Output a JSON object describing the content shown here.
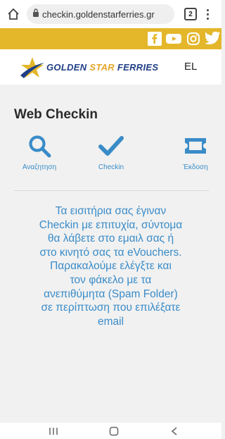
{
  "browser": {
    "url": "checkin.goldenstarferries.gr",
    "tab_count": "2"
  },
  "header": {
    "logo": {
      "word1": "GOLDEN",
      "word2": "STAR",
      "word3": "FERRIES"
    },
    "language": "EL"
  },
  "social": [
    "facebook-icon",
    "youtube-icon",
    "instagram-icon",
    "twitter-icon"
  ],
  "main": {
    "title": "Web Checkin",
    "steps": [
      {
        "label": "Αναζητηση",
        "icon": "search-icon"
      },
      {
        "label": "Checkin",
        "icon": "checkmark-icon"
      },
      {
        "label": "Έκδοση",
        "icon": "ticket-icon"
      }
    ],
    "message_lines": [
      "Τα εισιτήρια σας έγιναν",
      "Checkin με επιτυχία, σύντομα",
      "θα λάβετε στο εμαιλ σας ή",
      "στο κινητό σας τα eVouchers.",
      "Παρακαλούμε ελέγξτε και",
      "τον φάκελο με τα",
      "ανεπιθύμητα (Spam Folder)",
      "σε περίπτωση που επιλέξατε",
      "email"
    ]
  },
  "colors": {
    "accent_blue": "#3a8cc8",
    "brand_yellow": "#e4b62a",
    "brand_navy": "#1f3f86"
  }
}
